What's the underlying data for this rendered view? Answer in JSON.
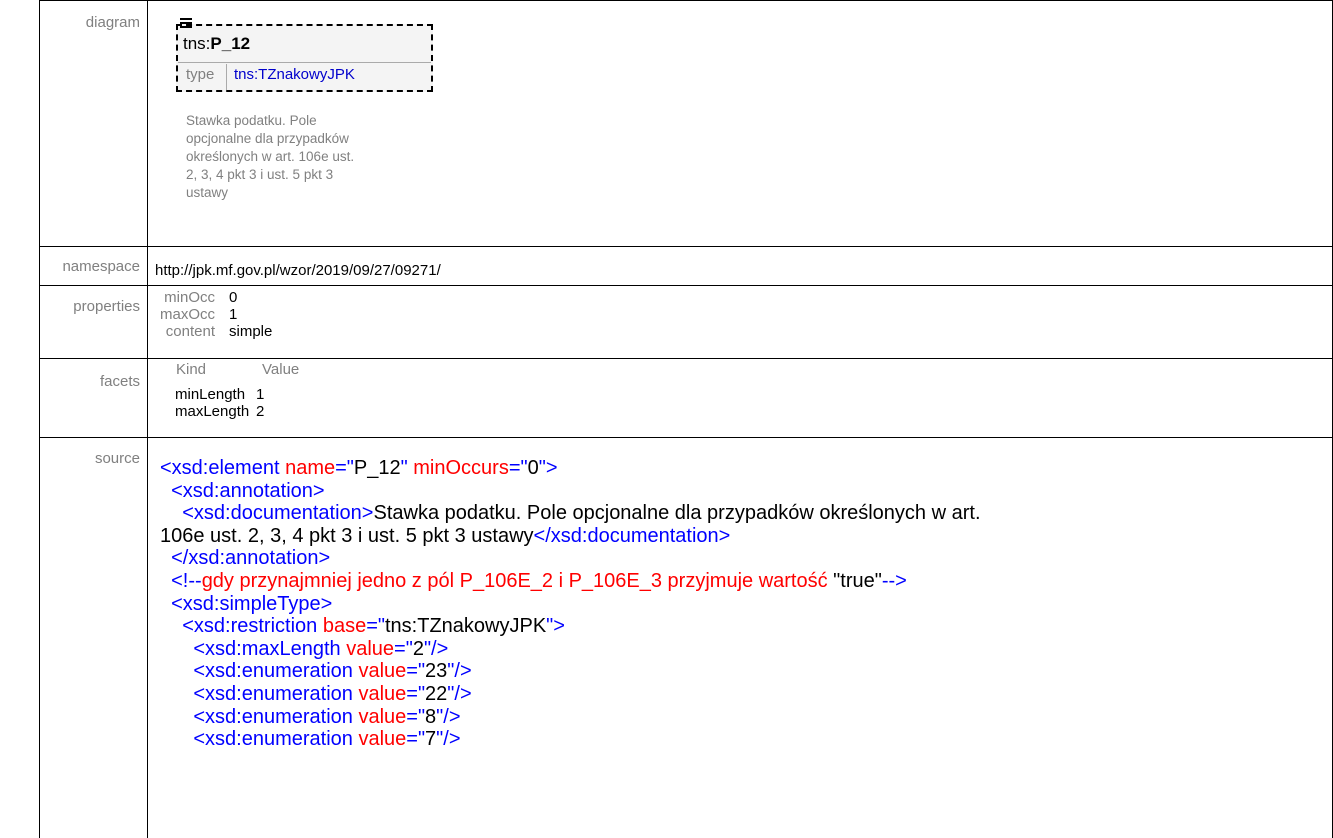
{
  "rows": {
    "diagram": "diagram",
    "namespace": "namespace",
    "properties": "properties",
    "facets": "facets",
    "source": "source"
  },
  "diagram": {
    "prefix": "tns:",
    "name": "P_12",
    "type_label": "type",
    "type_value": "tns:TZnakowyJPK",
    "doc_lines": [
      "Stawka podatku. Pole",
      "opcjonalne dla przypadków",
      "określonych w art. 106e ust.",
      "2, 3, 4 pkt 3 i ust. 5 pkt 3",
      "ustawy"
    ]
  },
  "namespace": "http://jpk.mf.gov.pl/wzor/2019/09/27/09271/",
  "properties": [
    {
      "key": "minOcc",
      "value": "0"
    },
    {
      "key": "maxOcc",
      "value": "1"
    },
    {
      "key": "content",
      "value": "simple"
    }
  ],
  "facets": {
    "headers": [
      "Kind",
      "Value"
    ],
    "rows": [
      {
        "kind": "minLength",
        "value": "1"
      },
      {
        "kind": "maxLength",
        "value": "2"
      }
    ]
  },
  "source_lines": [
    [
      [
        "t",
        "<xsd:element "
      ],
      [
        "a",
        "name"
      ],
      [
        "t",
        "=\""
      ],
      [
        "v",
        "P_12"
      ],
      [
        "t",
        "\" "
      ],
      [
        "a",
        "minOccurs"
      ],
      [
        "t",
        "=\""
      ],
      [
        "v",
        "0"
      ],
      [
        "t",
        "\">"
      ]
    ],
    [
      [
        "v",
        "  "
      ],
      [
        "t",
        "<xsd:annotation>"
      ]
    ],
    [
      [
        "v",
        "    "
      ],
      [
        "t",
        "<xsd:documentation>"
      ],
      [
        "v",
        "Stawka podatku. Pole opcjonalne dla przypadków określonych w art."
      ]
    ],
    [
      [
        "v",
        "106e ust. 2, 3, 4 pkt 3 i ust. 5 pkt 3 ustawy"
      ],
      [
        "t",
        "</xsd:documentation>"
      ]
    ],
    [
      [
        "v",
        "  "
      ],
      [
        "t",
        "</xsd:annotation>"
      ]
    ],
    [
      [
        "v",
        "  "
      ],
      [
        "t",
        "<!--"
      ],
      [
        "a",
        "gdy przynajmniej jedno z pól P_106E_2 i P_106E_3 przyjmuje wartość "
      ],
      [
        "v",
        "\"true\""
      ],
      [
        "t",
        "-->"
      ]
    ],
    [
      [
        "v",
        "  "
      ],
      [
        "t",
        "<xsd:simpleType>"
      ]
    ],
    [
      [
        "v",
        "    "
      ],
      [
        "t",
        "<xsd:restriction "
      ],
      [
        "a",
        "base"
      ],
      [
        "t",
        "=\""
      ],
      [
        "v",
        "tns:TZnakowyJPK"
      ],
      [
        "t",
        "\">"
      ]
    ],
    [
      [
        "v",
        "      "
      ],
      [
        "t",
        "<xsd:maxLength "
      ],
      [
        "a",
        "value"
      ],
      [
        "t",
        "=\""
      ],
      [
        "v",
        "2"
      ],
      [
        "t",
        "\"/>"
      ]
    ],
    [
      [
        "v",
        "      "
      ],
      [
        "t",
        "<xsd:enumeration "
      ],
      [
        "a",
        "value"
      ],
      [
        "t",
        "=\""
      ],
      [
        "v",
        "23"
      ],
      [
        "t",
        "\"/>"
      ]
    ],
    [
      [
        "v",
        "      "
      ],
      [
        "t",
        "<xsd:enumeration "
      ],
      [
        "a",
        "value"
      ],
      [
        "t",
        "=\""
      ],
      [
        "v",
        "22"
      ],
      [
        "t",
        "\"/>"
      ]
    ],
    [
      [
        "v",
        "      "
      ],
      [
        "t",
        "<xsd:enumeration "
      ],
      [
        "a",
        "value"
      ],
      [
        "t",
        "=\""
      ],
      [
        "v",
        "8"
      ],
      [
        "t",
        "\"/>"
      ]
    ],
    [
      [
        "v",
        "      "
      ],
      [
        "t",
        "<xsd:enumeration "
      ],
      [
        "a",
        "value"
      ],
      [
        "t",
        "=\""
      ],
      [
        "v",
        "7"
      ],
      [
        "t",
        "\"/>"
      ]
    ]
  ]
}
